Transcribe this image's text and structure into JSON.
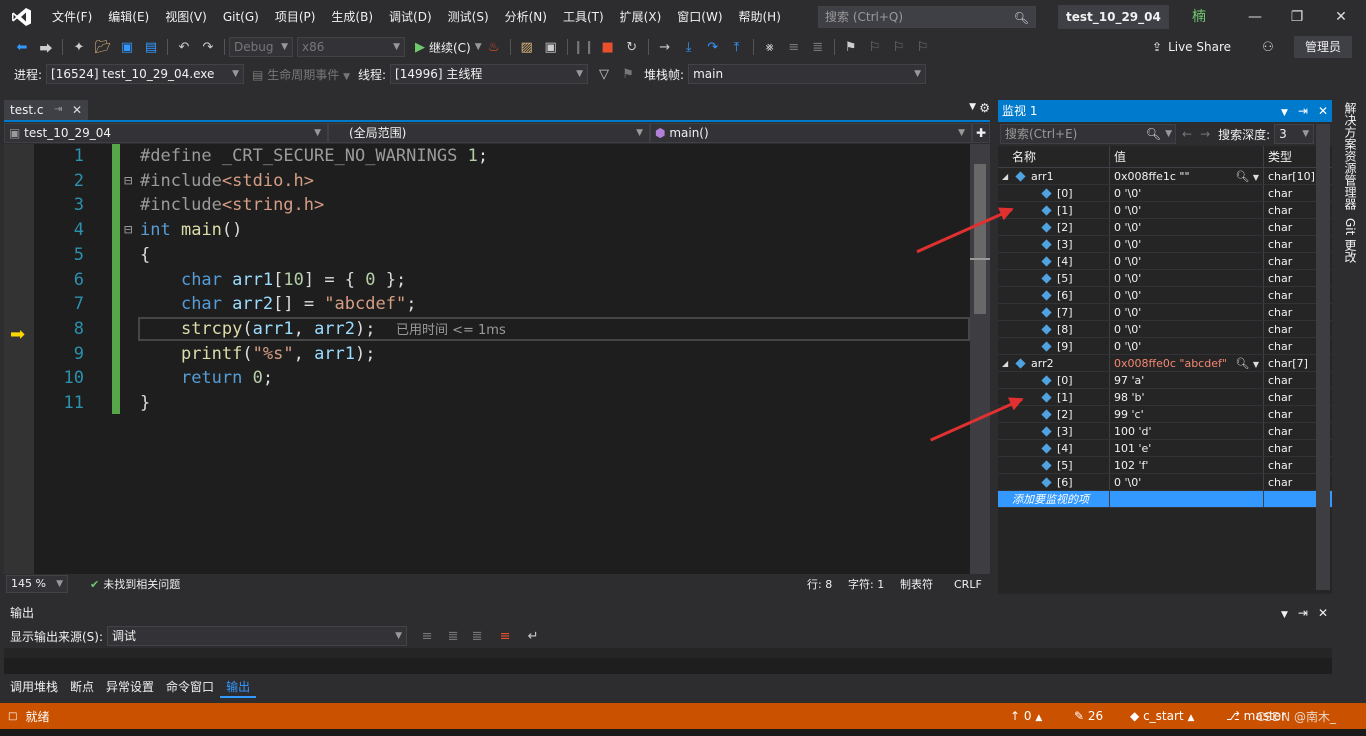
{
  "menu": [
    "文件(F)",
    "编辑(E)",
    "视图(V)",
    "Git(G)",
    "项目(P)",
    "生成(B)",
    "调试(D)",
    "测试(S)",
    "分析(N)",
    "工具(T)",
    "扩展(X)",
    "窗口(W)",
    "帮助(H)"
  ],
  "search_placeholder": "搜索 (Ctrl+Q)",
  "solution_title": "test_10_29_04",
  "avatar": "楠",
  "toolbar": {
    "config": "Debug",
    "platform": "x86",
    "continue_label": "继续(C)",
    "live_share": "Live Share",
    "admin": "管理员"
  },
  "debugbar": {
    "process_label": "进程:",
    "process_value": "[16524] test_10_29_04.exe",
    "lifecycle_label": "生命周期事件",
    "thread_label": "线程:",
    "thread_value": "[14996] 主线程",
    "stack_label": "堆栈帧:",
    "stack_value": "main"
  },
  "editor": {
    "tab_name": "test.c",
    "nav_project": "test_10_29_04",
    "nav_scope": "(全局范围)",
    "nav_func": "main()",
    "lines": [
      {
        "n": "1",
        "html": "<span class='pp'>#define</span> <span class='pp'>_CRT_SECURE_NO_WARNINGS</span> <span class='num'>1</span>;"
      },
      {
        "n": "2",
        "html": "<span class='pp'>#include</span><span class='str'>&lt;stdio.h&gt;</span>"
      },
      {
        "n": "3",
        "html": "<span class='pp'>#include</span><span class='str'>&lt;string.h&gt;</span>"
      },
      {
        "n": "4",
        "html": "<span class='kw'>int</span> <span class='fn'>main</span>()"
      },
      {
        "n": "5",
        "html": "{"
      },
      {
        "n": "6",
        "html": "    <span class='kw'>char</span> <span class='vr'>arr1</span>[<span class='num'>10</span>] = { <span class='num'>0</span> };"
      },
      {
        "n": "7",
        "html": "    <span class='kw'>char</span> <span class='vr'>arr2</span>[] = <span class='str'>\"abcdef\"</span>;"
      },
      {
        "n": "8",
        "html": "    <span class='fn'>strcpy</span>(<span class='vr'>arr1</span>, <span class='vr'>arr2</span>);  <span class='perf'>已用时间 &lt;= 1ms</span>"
      },
      {
        "n": "9",
        "html": "    <span class='fn'>printf</span>(<span class='str'>\"%s\"</span>, <span class='vr'>arr1</span>);"
      },
      {
        "n": "10",
        "html": "    <span class='kw'>return</span> <span class='num'>0</span>;"
      },
      {
        "n": "11",
        "html": "}"
      }
    ],
    "zoom": "145 %",
    "issues": "未找到相关问题",
    "row": "行: 8",
    "col": "字符: 1",
    "tab_mode": "制表符",
    "eol": "CRLF"
  },
  "watch": {
    "title": "监视 1",
    "search_placeholder": "搜索(Ctrl+E)",
    "depth_label": "搜索深度:",
    "depth_value": "3",
    "col_name": "名称",
    "col_value": "值",
    "col_type": "类型",
    "rows": [
      {
        "name": "arr1",
        "value": "0x008ffe1c \"\"",
        "type": "char[10]",
        "level": 0,
        "red": false
      },
      {
        "name": "[0]",
        "value": "0 '\\0'",
        "type": "char",
        "level": 1
      },
      {
        "name": "[1]",
        "value": "0 '\\0'",
        "type": "char",
        "level": 1
      },
      {
        "name": "[2]",
        "value": "0 '\\0'",
        "type": "char",
        "level": 1
      },
      {
        "name": "[3]",
        "value": "0 '\\0'",
        "type": "char",
        "level": 1
      },
      {
        "name": "[4]",
        "value": "0 '\\0'",
        "type": "char",
        "level": 1
      },
      {
        "name": "[5]",
        "value": "0 '\\0'",
        "type": "char",
        "level": 1
      },
      {
        "name": "[6]",
        "value": "0 '\\0'",
        "type": "char",
        "level": 1
      },
      {
        "name": "[7]",
        "value": "0 '\\0'",
        "type": "char",
        "level": 1
      },
      {
        "name": "[8]",
        "value": "0 '\\0'",
        "type": "char",
        "level": 1
      },
      {
        "name": "[9]",
        "value": "0 '\\0'",
        "type": "char",
        "level": 1
      },
      {
        "name": "arr2",
        "value": "0x008ffe0c \"abcdef\"",
        "type": "char[7]",
        "level": 0,
        "red": true
      },
      {
        "name": "[0]",
        "value": "97 'a'",
        "type": "char",
        "level": 1
      },
      {
        "name": "[1]",
        "value": "98 'b'",
        "type": "char",
        "level": 1
      },
      {
        "name": "[2]",
        "value": "99 'c'",
        "type": "char",
        "level": 1
      },
      {
        "name": "[3]",
        "value": "100 'd'",
        "type": "char",
        "level": 1
      },
      {
        "name": "[4]",
        "value": "101 'e'",
        "type": "char",
        "level": 1
      },
      {
        "name": "[5]",
        "value": "102 'f'",
        "type": "char",
        "level": 1
      },
      {
        "name": "[6]",
        "value": "0 '\\0'",
        "type": "char",
        "level": 1
      }
    ],
    "add_item": "添加要监视的项"
  },
  "side": {
    "explorer": "解决方案资源管理器",
    "git": "Git 更改"
  },
  "output": {
    "title": "输出",
    "source_label": "显示输出来源(S):",
    "source_value": "调试"
  },
  "bottom_tabs": [
    "调用堆栈",
    "断点",
    "异常设置",
    "命令窗口",
    "输出"
  ],
  "statusbar": {
    "ready": "就绪",
    "up": "0",
    "edits": "26",
    "repo": "c_start",
    "branch": "master",
    "watermark": "CSDN @南木_"
  },
  "colors": {
    "accent": "#007acc",
    "status": "#ca5100",
    "arrow": "#e03030"
  }
}
